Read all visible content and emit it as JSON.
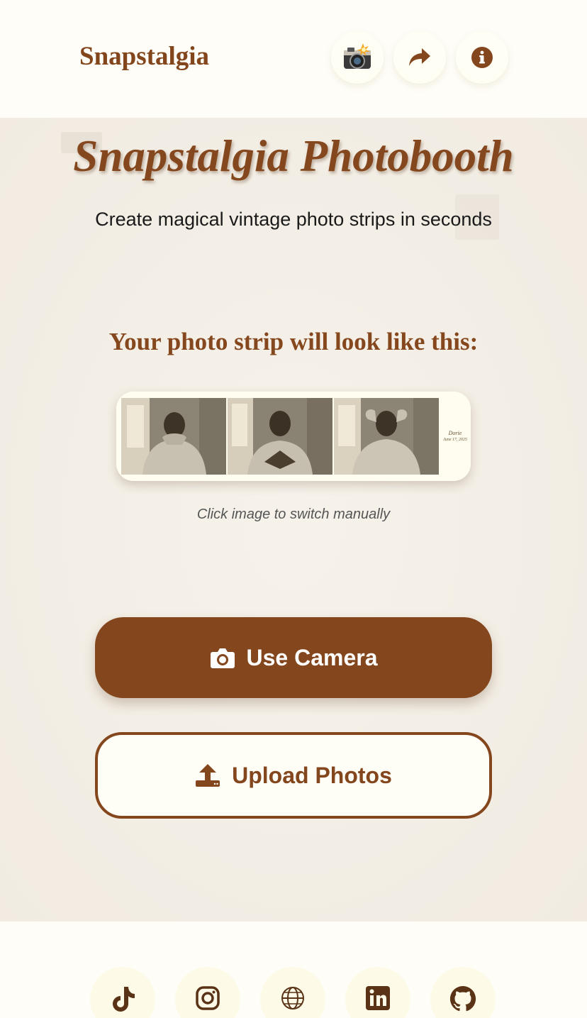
{
  "header": {
    "brand": "Snapstalgia"
  },
  "hero": {
    "title": "Snapstalgia Photobooth",
    "subtitle": "Create magical vintage photo strips in seconds"
  },
  "preview": {
    "heading": "Your photo strip will look like this:",
    "strip_name": "Dorie",
    "strip_date": "June 17, 2025",
    "hint": "Click image to switch manually"
  },
  "actions": {
    "camera_label": "Use Camera",
    "upload_label": "Upload Photos"
  },
  "colors": {
    "accent": "#83461d",
    "background": "#f4efe6",
    "surface": "#fefdf7"
  },
  "icons": {
    "header": [
      "camera-emoji-icon",
      "share-icon",
      "info-icon"
    ],
    "footer": [
      "tiktok-icon",
      "instagram-icon",
      "globe-icon",
      "linkedin-icon",
      "github-icon"
    ]
  }
}
